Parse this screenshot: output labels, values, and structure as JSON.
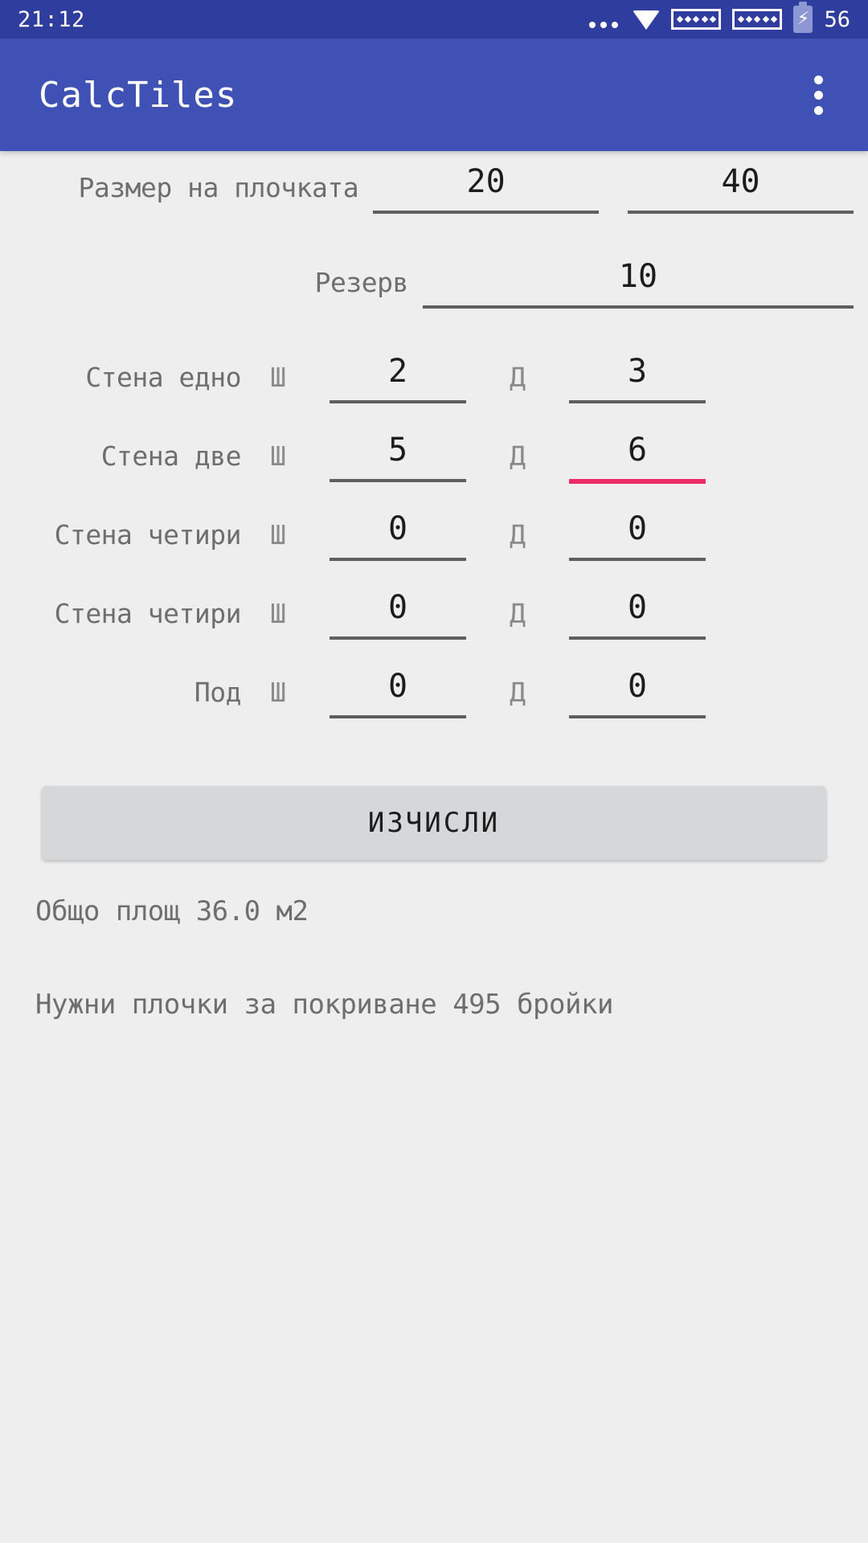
{
  "status_bar": {
    "clock": "21:12",
    "battery_percent": "56",
    "icons": [
      "more-horizontal-icon",
      "wifi-icon",
      "signal-icon",
      "signal-icon",
      "battery-charging-icon"
    ]
  },
  "app_bar": {
    "title": "CalcTiles",
    "overflow_label": "overflow-menu"
  },
  "form": {
    "tile_size": {
      "label": "Размер на плочката",
      "width_value": "20",
      "length_value": "40"
    },
    "reserve": {
      "label": "Резерв",
      "value": "10"
    },
    "unit_w": "Ш",
    "unit_l": "Д",
    "rows": [
      {
        "label": "Стена едно",
        "w": "2",
        "l": "3",
        "focused": "none"
      },
      {
        "label": "Стена две",
        "w": "5",
        "l": "6",
        "focused": "length"
      },
      {
        "label": "Стена четири",
        "w": "0",
        "l": "0",
        "focused": "none"
      },
      {
        "label": "Стена четири",
        "w": "0",
        "l": "0",
        "focused": "none"
      },
      {
        "label": "Под",
        "w": "0",
        "l": "0",
        "focused": "none"
      }
    ]
  },
  "actions": {
    "calculate_label": "ИЗЧИСЛИ"
  },
  "results": {
    "total_area": "Общо площ 36.0 м2",
    "tiles_needed": "Нужни плочки за покриване 495 бройки"
  },
  "colors": {
    "status_bar": "#2f3e9e",
    "app_bar": "#3f51b5",
    "background": "#eeeeee",
    "underline": "#5f5f5f",
    "focus_underline": "#ec2b64",
    "button": "#d6d7d9",
    "label_text": "#6e6e6e",
    "value_text": "#1c1c1c"
  }
}
